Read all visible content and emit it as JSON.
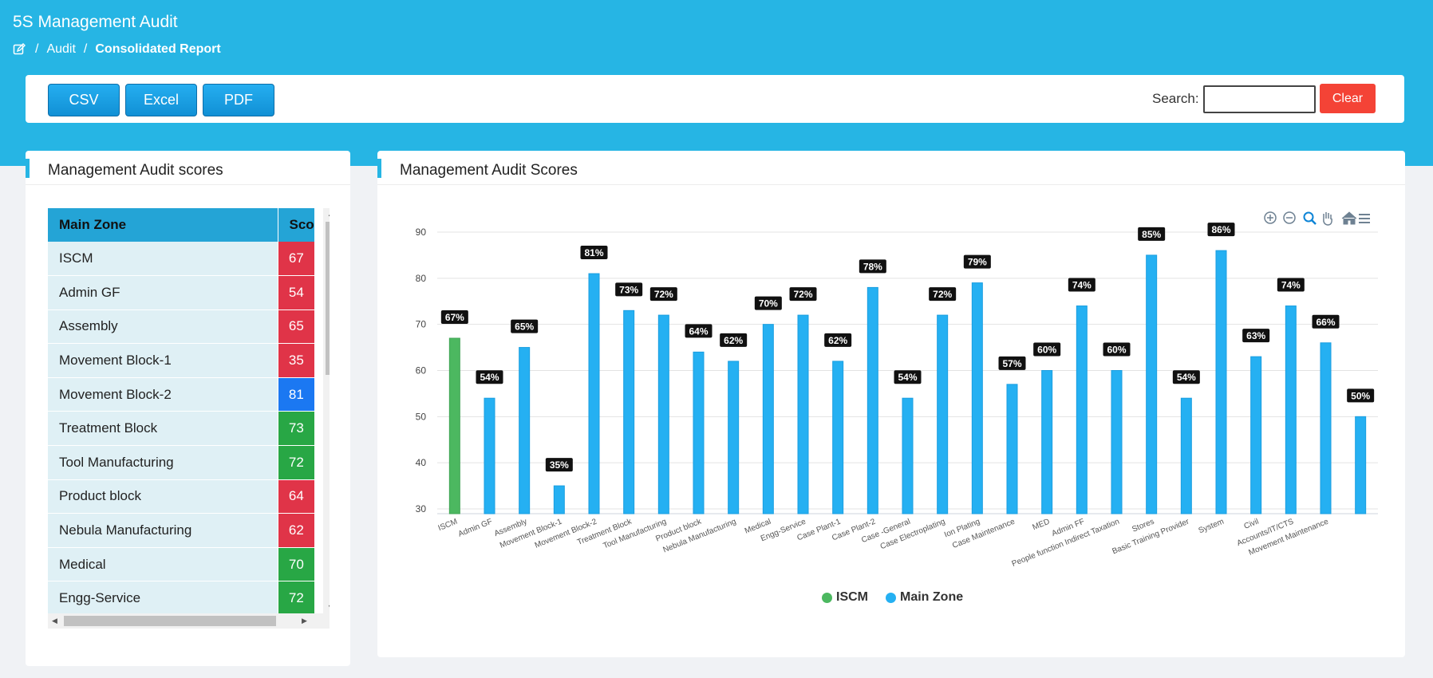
{
  "app": {
    "title": "5S Management Audit"
  },
  "breadcrumb": {
    "items": [
      "Audit",
      "Consolidated Report"
    ],
    "separator": "/"
  },
  "toolbar": {
    "csv_label": "CSV",
    "excel_label": "Excel",
    "pdf_label": "PDF",
    "search_label": "Search:",
    "search_value": "",
    "clear_label": "Clear"
  },
  "table_panel": {
    "title": "Management Audit scores",
    "columns": [
      "Main Zone",
      "Sco"
    ],
    "rows": [
      {
        "zone": "ISCM",
        "score": "67",
        "color": "#e03448"
      },
      {
        "zone": "Admin GF",
        "score": "54",
        "color": "#e03448"
      },
      {
        "zone": "Assembly",
        "score": "65",
        "color": "#e03448"
      },
      {
        "zone": "Movement Block-1",
        "score": "35",
        "color": "#e03448"
      },
      {
        "zone": "Movement Block-2",
        "score": "81",
        "color": "#1b78f2"
      },
      {
        "zone": "Treatment Block",
        "score": "73",
        "color": "#28a745"
      },
      {
        "zone": "Tool Manufacturing",
        "score": "72",
        "color": "#28a745"
      },
      {
        "zone": "Product block",
        "score": "64",
        "color": "#e03448"
      },
      {
        "zone": "Nebula Manufacturing",
        "score": "62",
        "color": "#e03448"
      },
      {
        "zone": "Medical",
        "score": "70",
        "color": "#28a745"
      },
      {
        "zone": "Engg-Service",
        "score": "72",
        "color": "#28a745"
      }
    ]
  },
  "chart_panel": {
    "title": "Management Audit Scores"
  },
  "colors": {
    "accent": "#26b5e4",
    "main_zone": "#25b0f2",
    "iscm": "#4cb860",
    "label_bg": "#111111"
  },
  "chart_data": {
    "type": "bar",
    "title": "Management Audit Scores",
    "ylim": [
      30,
      90
    ],
    "yticks": [
      30,
      40,
      50,
      60,
      70,
      80,
      90
    ],
    "grid": true,
    "legend_position": "bottom-center",
    "categories": [
      "ISCM",
      "Admin GF",
      "Assembly",
      "Movement Block-1",
      "Movement Block-2",
      "Treatment Block",
      "Tool Manufacturing",
      "Product block",
      "Nebula Manufacturing",
      "Medical",
      "Engg-Service",
      "Case Plant-1",
      "Case Plant-2",
      "Case -General",
      "Case Electroplating",
      "Ion Plating",
      "Case Maintenance",
      "MED",
      "Admin FF",
      "People function Indirect Taxation",
      "Stores",
      "Basic Training Provider",
      "System",
      "Civil",
      "Accounts/IT/CTS",
      "Movement Maintenance"
    ],
    "values": [
      67,
      54,
      65,
      35,
      81,
      73,
      72,
      64,
      62,
      70,
      72,
      62,
      78,
      54,
      72,
      79,
      57,
      60,
      74,
      60,
      85,
      54,
      86,
      63,
      74,
      66,
      50
    ],
    "data_labels": [
      "67%",
      "54%",
      "65%",
      "35%",
      "81%",
      "73%",
      "72%",
      "64%",
      "62%",
      "70%",
      "72%",
      "62%",
      "78%",
      "54%",
      "72%",
      "79%",
      "57%",
      "60%",
      "74%",
      "60%",
      "85%",
      "54%",
      "86%",
      "63%",
      "74%",
      "66%",
      "50%"
    ],
    "series": [
      {
        "name": "ISCM",
        "color": "#4cb860"
      },
      {
        "name": "Main Zone",
        "color": "#25b0f2"
      }
    ]
  }
}
